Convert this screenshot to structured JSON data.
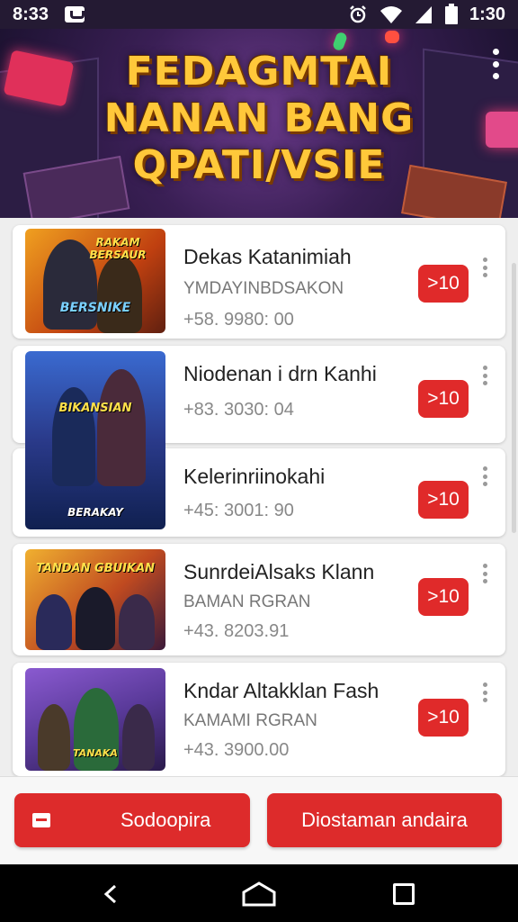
{
  "status_bar": {
    "time_left": "8:33",
    "time_right": "1:30",
    "icons": [
      "notification-icon",
      "alarm-icon",
      "wifi-icon",
      "signal-icon",
      "battery-icon"
    ]
  },
  "hero": {
    "title_line1": "FEDAGMTAI",
    "title_line2": "NANAN BANG",
    "title_line3": "QPATI/VSIE"
  },
  "items": [
    {
      "name": "Dekas Katanimiah",
      "subtitle": "YMDAYINBDSAKON",
      "price": "+58. 9980: 00",
      "action": ">10",
      "thumb_text_top": "RAKAM BERSAUR",
      "thumb_text_bottom": "BERSNIKE"
    },
    {
      "name": "Niodenan i drn Kanhi",
      "subtitle": "",
      "price": "+83. 3030: 04",
      "action": ">10",
      "thumb_text_top": "BIKANSIAN",
      "thumb_text_bottom": "BERAKAY"
    },
    {
      "name": "Kelerinriinokahi",
      "subtitle": "",
      "price": "+45: 3001: 90",
      "action": ">10"
    },
    {
      "name": "SunrdeiAlsaks Klann",
      "subtitle": "BAMAN RGRAN",
      "price": "+43. 8203.91",
      "action": ">10",
      "thumb_text_top": "TANDAN GBUIKAN",
      "thumb_text_bottom": ""
    },
    {
      "name": "Kndar Altakklan Fash",
      "subtitle": "KAMAMI RGRAN",
      "price": "+43. 3900.00",
      "action": ">10",
      "thumb_text_top": "",
      "thumb_text_bottom": "TANAKA"
    }
  ],
  "actions": {
    "left_label": "Sodoopira",
    "right_label": "Diostaman andaira"
  },
  "colors": {
    "accent": "#e02a2a",
    "hero_title": "#ffc83a",
    "status_bar": "#241a33"
  }
}
